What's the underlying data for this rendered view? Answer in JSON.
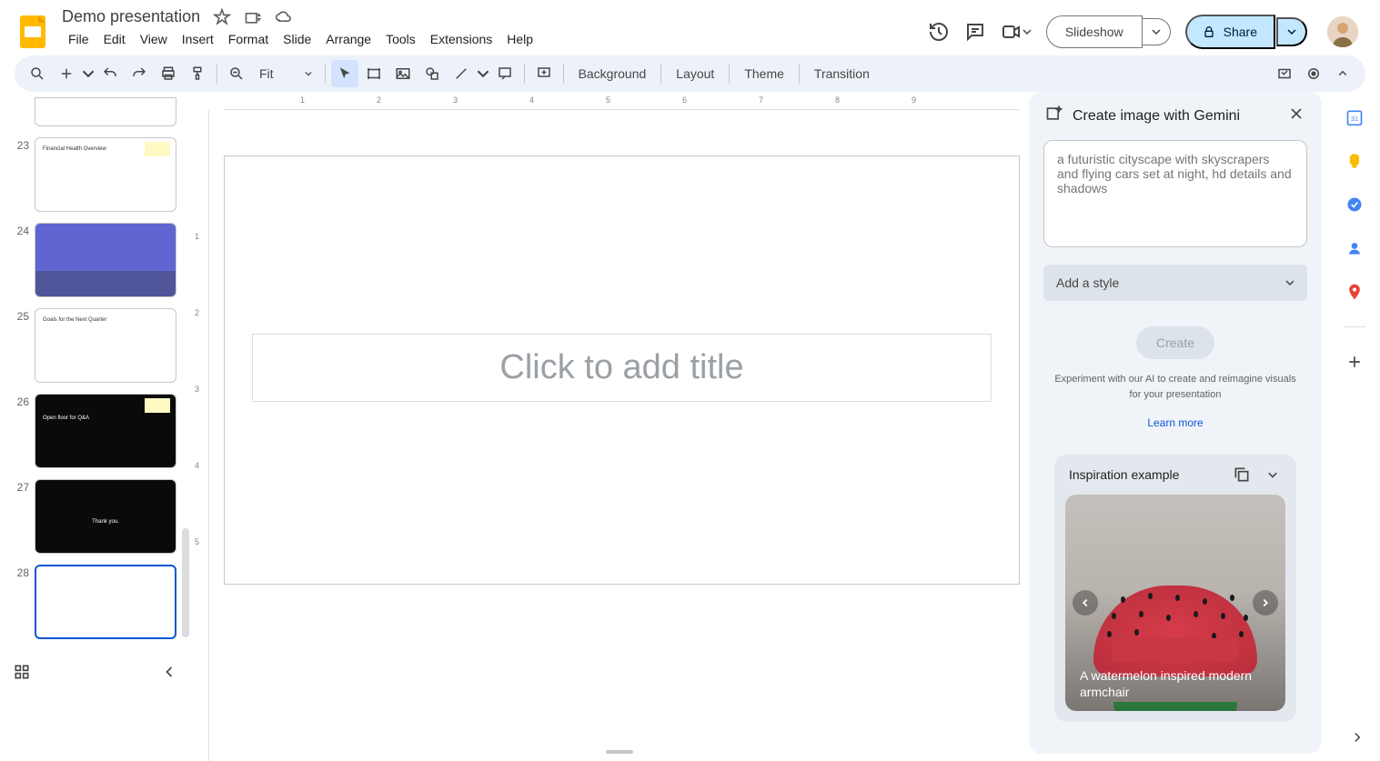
{
  "doc": {
    "title": "Demo presentation"
  },
  "menu": {
    "file": "File",
    "edit": "Edit",
    "view": "View",
    "insert": "Insert",
    "format": "Format",
    "slide": "Slide",
    "arrange": "Arrange",
    "tools": "Tools",
    "extensions": "Extensions",
    "help": "Help"
  },
  "header": {
    "slideshow": "Slideshow",
    "share": "Share"
  },
  "toolbar": {
    "zoom": "Fit",
    "background": "Background",
    "layout": "Layout",
    "theme": "Theme",
    "transition": "Transition"
  },
  "thumbs": [
    {
      "num": "23",
      "kind": "light",
      "title": "Financial Health Overview"
    },
    {
      "num": "24",
      "kind": "purple",
      "title": ""
    },
    {
      "num": "25",
      "kind": "light",
      "title": "Goals for the Next Quarter"
    },
    {
      "num": "26",
      "kind": "dark",
      "title": "Open floor for Q&A"
    },
    {
      "num": "27",
      "kind": "dark",
      "title": "Thank you."
    },
    {
      "num": "28",
      "kind": "blank",
      "title": ""
    }
  ],
  "canvas": {
    "title_placeholder": "Click to add title"
  },
  "gemini": {
    "title": "Create image with Gemini",
    "prompt_placeholder": "a futuristic cityscape with skyscrapers and flying cars set at night, hd details and shadows",
    "style_label": "Add a style",
    "create": "Create",
    "desc": "Experiment with our AI to create and reimagine visuals for your presentation",
    "learn": "Learn more",
    "inspiration_title": "Inspiration example",
    "inspiration_caption": "A watermelon inspired modern armchair"
  },
  "ruler_h": [
    "1",
    "2",
    "3",
    "4",
    "5",
    "6",
    "7",
    "8",
    "9"
  ],
  "ruler_v": [
    "1",
    "2",
    "3",
    "4",
    "5"
  ]
}
